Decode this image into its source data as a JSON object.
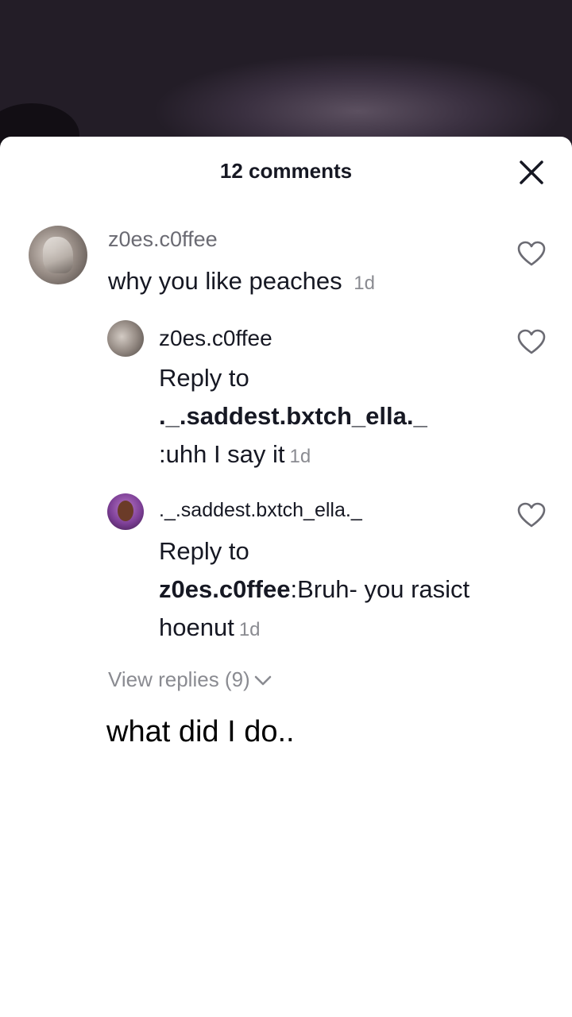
{
  "header": {
    "title": "12 comments"
  },
  "comments": {
    "main": {
      "username": "z0es.c0ffee",
      "text": "why you like peaches",
      "time": "1d"
    },
    "replies": [
      {
        "username": "z0es.c0ffee",
        "prefix": "Reply to ",
        "mention": "._.saddest.bxtch_ella._",
        "text": ":uhh I say it",
        "time": "1d"
      },
      {
        "username": "._.saddest.bxtch_ella._",
        "prefix": "Reply to ",
        "mention": "z0es.c0ffee",
        "text": ":Bruh- you rasict hoenut",
        "time": "1d"
      }
    ],
    "view_replies": "View replies (9)"
  },
  "caption": {
    "text": "what did I do.."
  },
  "icons": {
    "close": "close-icon",
    "like": "heart-outline-icon",
    "chevron": "chevron-down-icon"
  },
  "colors": {
    "primary_text": "#161823",
    "secondary_text": "#8a8b91",
    "sheet_bg": "#ffffff"
  }
}
